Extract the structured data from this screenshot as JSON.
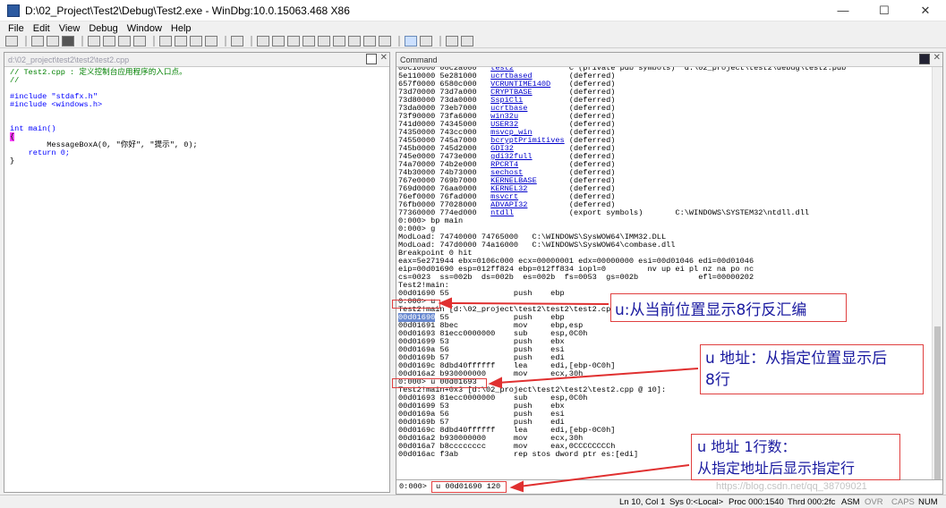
{
  "window": {
    "title": "D:\\02_Project\\Test2\\Debug\\Test2.exe - WinDbg:10.0.15063.468 X86",
    "minimize": "—",
    "maximize": "☐",
    "close": "✕"
  },
  "menu": [
    "File",
    "Edit",
    "View",
    "Debug",
    "Window",
    "Help"
  ],
  "source_pane": {
    "path": "d:\\02_project\\test2\\test2\\test2.cpp",
    "lines": [
      "// Test2.cpp : 定义控制台应用程序的入口点。",
      "//",
      "",
      "#include \"stdafx.h\"",
      "#include <windows.h>",
      "",
      "",
      "int main()",
      "{",
      "        MessageBoxA(0, \"你好\", \"提示\", 0);",
      "    return 0;",
      "}"
    ]
  },
  "command_pane": {
    "title": "Command",
    "modules": [
      [
        "00c10000 00c2a000",
        "test2",
        "C (private pdb symbols)  d:\\02_project\\test2\\debug\\test2.pdb"
      ],
      [
        "5e110000 5e281000",
        "ucrtbased",
        "(deferred)"
      ],
      [
        "657f0000 6580c000",
        "VCRUNTIME140D",
        "(deferred)"
      ],
      [
        "73d70000 73d7a000",
        "CRYPTBASE",
        "(deferred)"
      ],
      [
        "73d80000 73da0000",
        "SspiCli",
        "(deferred)"
      ],
      [
        "73da0000 73eb7000",
        "ucrtbase",
        "(deferred)"
      ],
      [
        "73f90000 73fa6000",
        "win32u",
        "(deferred)"
      ],
      [
        "741d0000 74345000",
        "USER32",
        "(deferred)"
      ],
      [
        "74350000 743cc000",
        "msvcp_win",
        "(deferred)"
      ],
      [
        "74550000 745a7000",
        "bcryptPrimitives",
        "(deferred)"
      ],
      [
        "745b0000 745d2000",
        "GDI32",
        "(deferred)"
      ],
      [
        "745e0000 7473e000",
        "gdi32full",
        "(deferred)"
      ],
      [
        "74a70000 74b2e000",
        "RPCRT4",
        "(deferred)"
      ],
      [
        "74b30000 74b73000",
        "sechost",
        "(deferred)"
      ],
      [
        "767e0000 769b7000",
        "KERNELBASE",
        "(deferred)"
      ],
      [
        "769d0000 76aa0000",
        "KERNEL32",
        "(deferred)"
      ],
      [
        "76ef0000 76fad000",
        "msvcrt",
        "(deferred)"
      ],
      [
        "76fb0000 77028000",
        "ADVAPI32",
        "(deferred)"
      ],
      [
        "77360000 774ed000",
        "ntdll",
        "(export symbols)       C:\\WINDOWS\\SYSTEM32\\ntdll.dll"
      ]
    ],
    "lines_a": [
      "0:000> bp main",
      "0:000> g",
      "ModLoad: 74740000 74765000   C:\\WINDOWS\\SysWOW64\\IMM32.DLL",
      "ModLoad: 747d0000 74a16000   C:\\WINDOWS\\SysWOW64\\combase.dll",
      "Breakpoint 0 hit",
      "eax=5e271944 ebx=0106c000 ecx=00000001 edx=00000000 esi=00d01046 edi=00d01046",
      "eip=00d01690 esp=012ff824 ebp=012ff834 iopl=0         nv up ei pl nz na po nc",
      "cs=0023  ss=002b  ds=002b  es=002b  fs=0053  gs=002b             efl=00000202",
      "Test2!main:",
      "00d01690 55              push    ebp"
    ],
    "cmd_u": "0:000> u",
    "lines_b_head": "Test2!main [d:\\02_project\\test2\\test2\\test2.cpp @ 8]:",
    "lines_b_first_addr": "00d01690",
    "lines_b_first_rest": " 55              push    ebp",
    "lines_b": [
      "00d01691 8bec            mov     ebp,esp",
      "00d01693 81ecc0000000    sub     esp,0C0h",
      "00d01699 53              push    ebx",
      "00d0169a 56              push    esi",
      "00d0169b 57              push    edi",
      "00d0169c 8dbd40ffffff    lea     edi,[ebp-0C0h]",
      "00d016a2 b930000000      mov     ecx,30h"
    ],
    "cmd_u_addr": "0:000> u 00d01693",
    "lines_c": [
      "Test2!main+0x3 [d:\\02_project\\test2\\test2\\test2.cpp @ 10]:",
      "00d01693 81ecc0000000    sub     esp,0C0h",
      "00d01699 53              push    ebx",
      "00d0169a 56              push    esi",
      "00d0169b 57              push    edi",
      "00d0169c 8dbd40ffffff    lea     edi,[ebp-0C0h]",
      "00d016a2 b930000000      mov     ecx,30h",
      "00d016a7 b8cccccccc      mov     eax,0CCCCCCCCh",
      "00d016ac f3ab            rep stos dword ptr es:[edi]"
    ],
    "prompt": "0:000>",
    "input_value": "u 00d01690 120"
  },
  "annotations": {
    "a1": "u:从当前位置显示8行反汇编",
    "a2_line1": "u 地址：从指定位置显示后",
    "a2_line2": "8行",
    "a3_line1": "u 地址 1行数：",
    "a3_line2": "从指定地址后显示指定行"
  },
  "status": {
    "pos": "Ln 10, Col 1",
    "sys": "Sys 0:<Local>",
    "proc": "Proc 000:1540",
    "thrd": "Thrd 000:2fc",
    "asm": "ASM",
    "ovr": "OVR",
    "caps": "CAPS",
    "num": "NUM"
  },
  "watermark": "https://blog.csdn.net/qq_38709021"
}
